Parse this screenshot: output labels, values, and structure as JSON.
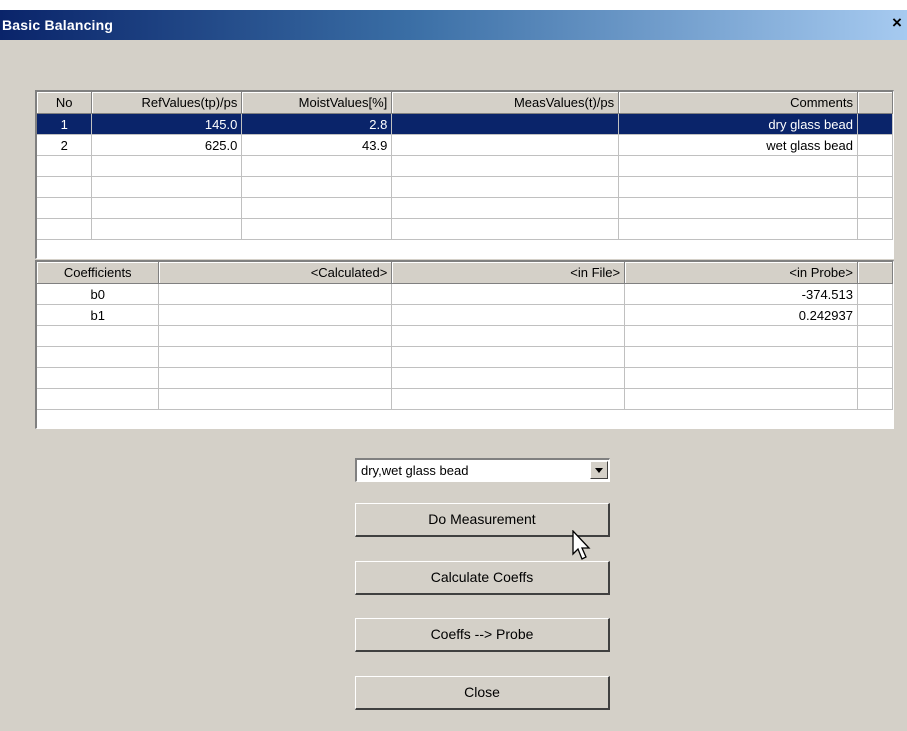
{
  "window": {
    "title": "Basic Balancing",
    "close_glyph": "×"
  },
  "ref_table": {
    "columns": [
      "No",
      "RefValues(tp)/ps",
      "MoistValues[%]",
      "MeasValues(t)/ps",
      "Comments"
    ],
    "rows": [
      {
        "no": "1",
        "ref": "145.0",
        "moist": "2.8",
        "meas": "",
        "comment": "dry glass bead",
        "selected": true
      },
      {
        "no": "2",
        "ref": "625.0",
        "moist": "43.9",
        "meas": "",
        "comment": "wet glass bead",
        "selected": false
      },
      {
        "no": "",
        "ref": "",
        "moist": "",
        "meas": "",
        "comment": ""
      },
      {
        "no": "",
        "ref": "",
        "moist": "",
        "meas": "",
        "comment": ""
      },
      {
        "no": "",
        "ref": "",
        "moist": "",
        "meas": "",
        "comment": ""
      },
      {
        "no": "",
        "ref": "",
        "moist": "",
        "meas": "",
        "comment": ""
      }
    ]
  },
  "coeff_table": {
    "columns": [
      "Coefficients",
      "<Calculated>",
      "<in File>",
      "<in Probe>"
    ],
    "rows": [
      {
        "name": "b0",
        "calc": "",
        "file": "",
        "probe": "-374.513"
      },
      {
        "name": "b1",
        "calc": "",
        "file": "",
        "probe": "0.242937"
      },
      {
        "name": "",
        "calc": "",
        "file": "",
        "probe": ""
      },
      {
        "name": "",
        "calc": "",
        "file": "",
        "probe": ""
      },
      {
        "name": "",
        "calc": "",
        "file": "",
        "probe": ""
      },
      {
        "name": "",
        "calc": "",
        "file": "",
        "probe": ""
      }
    ]
  },
  "material_select": {
    "value": "dry,wet glass bead"
  },
  "buttons": {
    "do_measurement": "Do Measurement",
    "calculate": "Calculate Coeffs",
    "to_probe": "Coeffs --> Probe",
    "close": "Close"
  }
}
